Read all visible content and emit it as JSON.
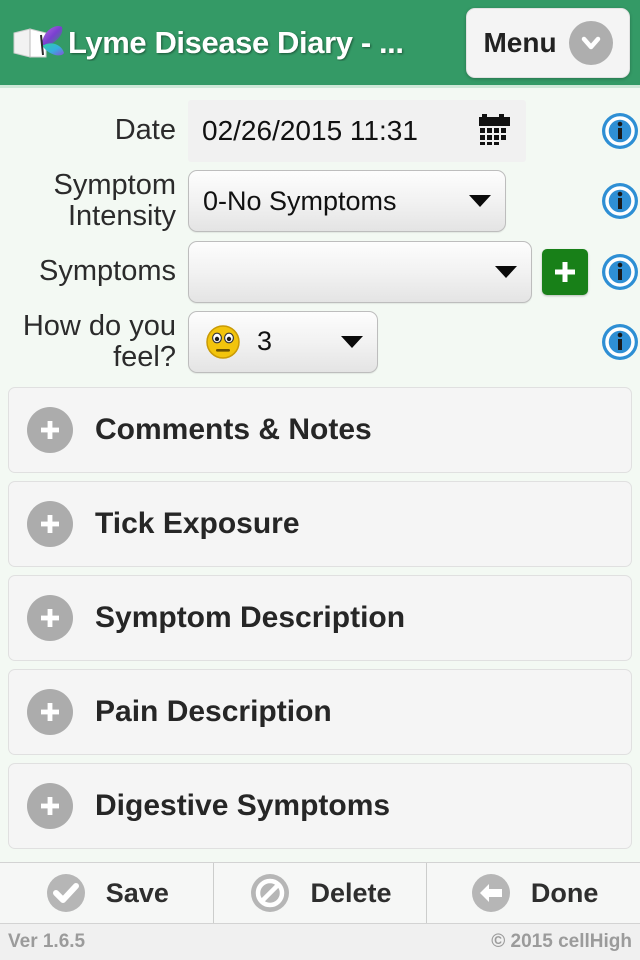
{
  "header": {
    "logo_icon": "book-butterfly-logo",
    "title": "Lyme Disease Diary - ...",
    "menu_label": "Menu",
    "menu_icon": "chevron-down-icon",
    "background_color": "#349a66"
  },
  "form": {
    "date": {
      "label": "Date",
      "value": "02/26/2015 11:31",
      "calendar_icon": "calendar-icon",
      "info_icon": "info-icon"
    },
    "symptom_intensity": {
      "label_line1": "Symptom",
      "label_line2": "Intensity",
      "value": "0-No Symptoms",
      "caret_icon": "chevron-down-icon",
      "info_icon": "info-icon"
    },
    "symptoms": {
      "label": "Symptoms",
      "value": "",
      "caret_icon": "chevron-down-icon",
      "add_icon": "plus-icon",
      "add_color": "#188018",
      "info_icon": "info-icon"
    },
    "how_do_you_feel": {
      "label_line1": "How do you",
      "label_line2": "feel?",
      "value": "3",
      "emoji_icon": "neutral-face-emoji",
      "caret_icon": "chevron-down-icon",
      "info_icon": "info-icon"
    }
  },
  "sections": [
    {
      "label": "Comments & Notes",
      "icon": "plus-circle-icon"
    },
    {
      "label": "Tick Exposure",
      "icon": "plus-circle-icon"
    },
    {
      "label": "Symptom Description",
      "icon": "plus-circle-icon"
    },
    {
      "label": "Pain Description",
      "icon": "plus-circle-icon"
    },
    {
      "label": "Digestive Symptoms",
      "icon": "plus-circle-icon"
    }
  ],
  "toolbar": [
    {
      "label": "Save",
      "icon": "check-circle-icon"
    },
    {
      "label": "Delete",
      "icon": "prohibition-icon"
    },
    {
      "label": "Done",
      "icon": "arrow-left-circle-icon"
    }
  ],
  "footer": {
    "version": "Ver 1.6.5",
    "copyright": "© 2015 cellHigh"
  }
}
